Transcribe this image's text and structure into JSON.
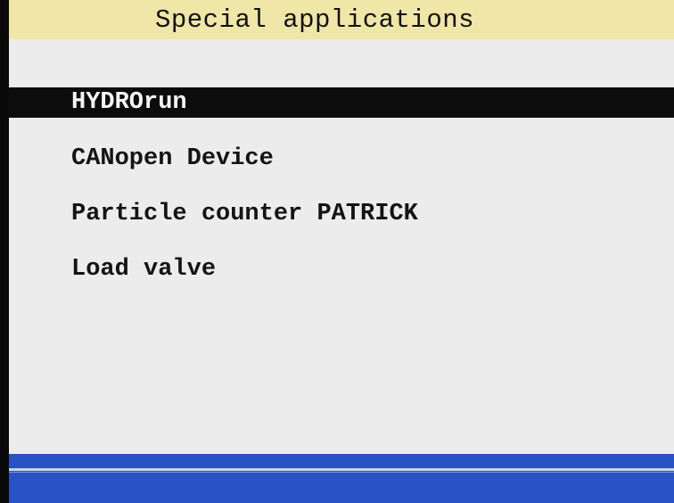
{
  "header": {
    "title": "Special applications"
  },
  "menu": {
    "items": [
      {
        "label": "HYDROrun",
        "selected": true
      },
      {
        "label": "CANopen Device",
        "selected": false
      },
      {
        "label": "Particle counter PATRICK",
        "selected": false
      },
      {
        "label": "Load valve",
        "selected": false
      }
    ]
  },
  "colors": {
    "title_bg": "#efe6a8",
    "screen_bg": "#ececec",
    "selection_bg": "#0c0c0c",
    "status_bar": "#2a52c4"
  }
}
